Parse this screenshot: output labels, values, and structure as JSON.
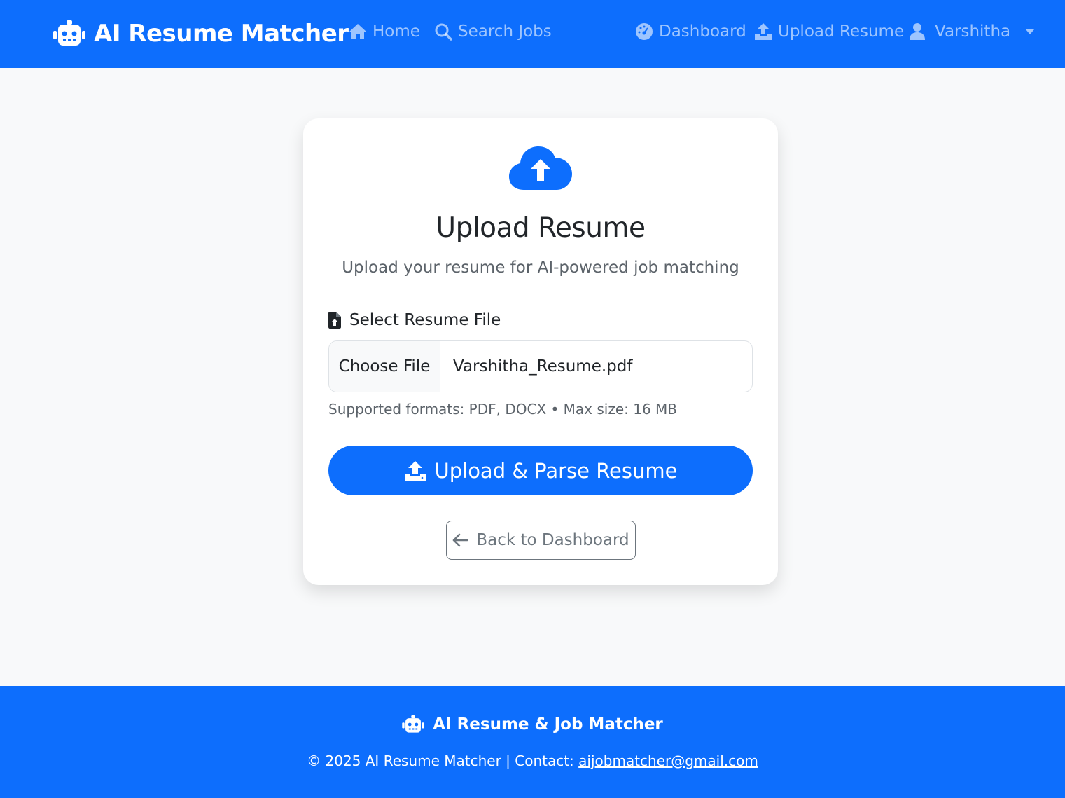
{
  "navbar": {
    "brand": "AI Resume Matcher",
    "brand_icon": "robot-icon",
    "links": {
      "home": "Home",
      "search_jobs": "Search Jobs",
      "dashboard": "Dashboard",
      "upload_resume": "Upload Resume",
      "user": "Varshitha"
    }
  },
  "card": {
    "icon": "cloud-upload-icon",
    "title": "Upload Resume",
    "subtitle": "Upload your resume for AI-powered job matching",
    "field_label": "Select Resume File",
    "choose_button": "Choose File",
    "file_name": "Varshitha_Resume.pdf",
    "help_text": "Supported formats: PDF, DOCX • Max size: 16 MB",
    "submit_button": "Upload & Parse Resume",
    "back_button": "Back to Dashboard"
  },
  "footer": {
    "brand": "AI Resume & Job Matcher",
    "copyright": "© 2025 AI Resume Matcher | Contact: ",
    "email": "aijobmatcher@gmail.com"
  },
  "colors": {
    "primary": "#0d6efd",
    "background": "#f8f9fa",
    "secondary": "#6c757d"
  }
}
